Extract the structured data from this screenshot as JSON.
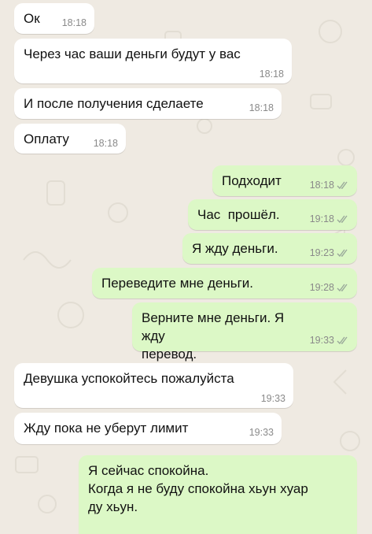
{
  "colors": {
    "background": "#efeae2",
    "incoming_bubble": "#ffffff",
    "outgoing_bubble": "#dcf8c6",
    "time_text": "#8a8a8a",
    "read_ticks": "#9aa99a"
  },
  "messages": [
    {
      "direction": "in",
      "text": "Ок",
      "time": "18:18"
    },
    {
      "direction": "in",
      "text": "Через час ваши деньги будут у вас",
      "time": "18:18"
    },
    {
      "direction": "in",
      "text": "И после получения сделаете",
      "time": "18:18"
    },
    {
      "direction": "in",
      "text": "Оплату",
      "time": "18:18"
    },
    {
      "direction": "out",
      "text": "Подходит",
      "time": "18:18",
      "status_icon": "double-check-icon"
    },
    {
      "direction": "out",
      "text": "Час  прошёл.",
      "time": "19:18",
      "status_icon": "double-check-icon"
    },
    {
      "direction": "out",
      "text": "Я жду деньги.",
      "time": "19:23",
      "status_icon": "double-check-icon"
    },
    {
      "direction": "out",
      "text": "Переведите мне деньги.",
      "time": "19:28",
      "status_icon": "double-check-icon"
    },
    {
      "direction": "out",
      "text": "Верните мне деньги. Я жду\nперевод.",
      "time": "19:33",
      "status_icon": "double-check-icon"
    },
    {
      "direction": "in",
      "text": "Девушка успокойтесь пожалуйста",
      "time": "19:33"
    },
    {
      "direction": "in",
      "text": "Жду пока не уберут лимит",
      "time": "19:33"
    },
    {
      "direction": "out",
      "text": "Я сейчас спокойна.\nКогда я не буду спокойна хьун хуар\nду хьун."
    }
  ]
}
